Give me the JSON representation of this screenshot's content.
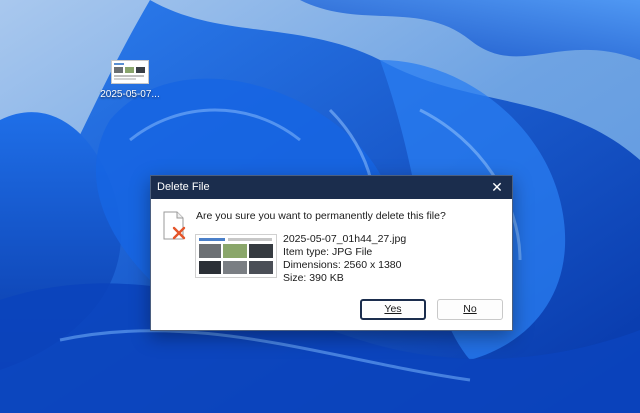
{
  "desktop": {
    "icon_label": "2025-05-07..."
  },
  "dialog": {
    "title": "Delete File",
    "close_glyph": "✕",
    "question": "Are you sure you want to permanently delete this file?",
    "file": {
      "name": "2025-05-07_01h44_27.jpg",
      "type": "Item type: JPG File",
      "dimensions": "Dimensions: 2560 x 1380",
      "size": "Size: 390 KB"
    },
    "buttons": {
      "yes_label": "Yes",
      "no_label": "No"
    }
  },
  "colors": {
    "titlebar": "#1b2d4d",
    "wallpaper_deep": "#0a3fb5",
    "wallpaper_light": "#7fb2e8",
    "delete_x": "#e4552a"
  },
  "icons": {
    "file_delete": "file-delete-icon",
    "close": "close-icon"
  }
}
